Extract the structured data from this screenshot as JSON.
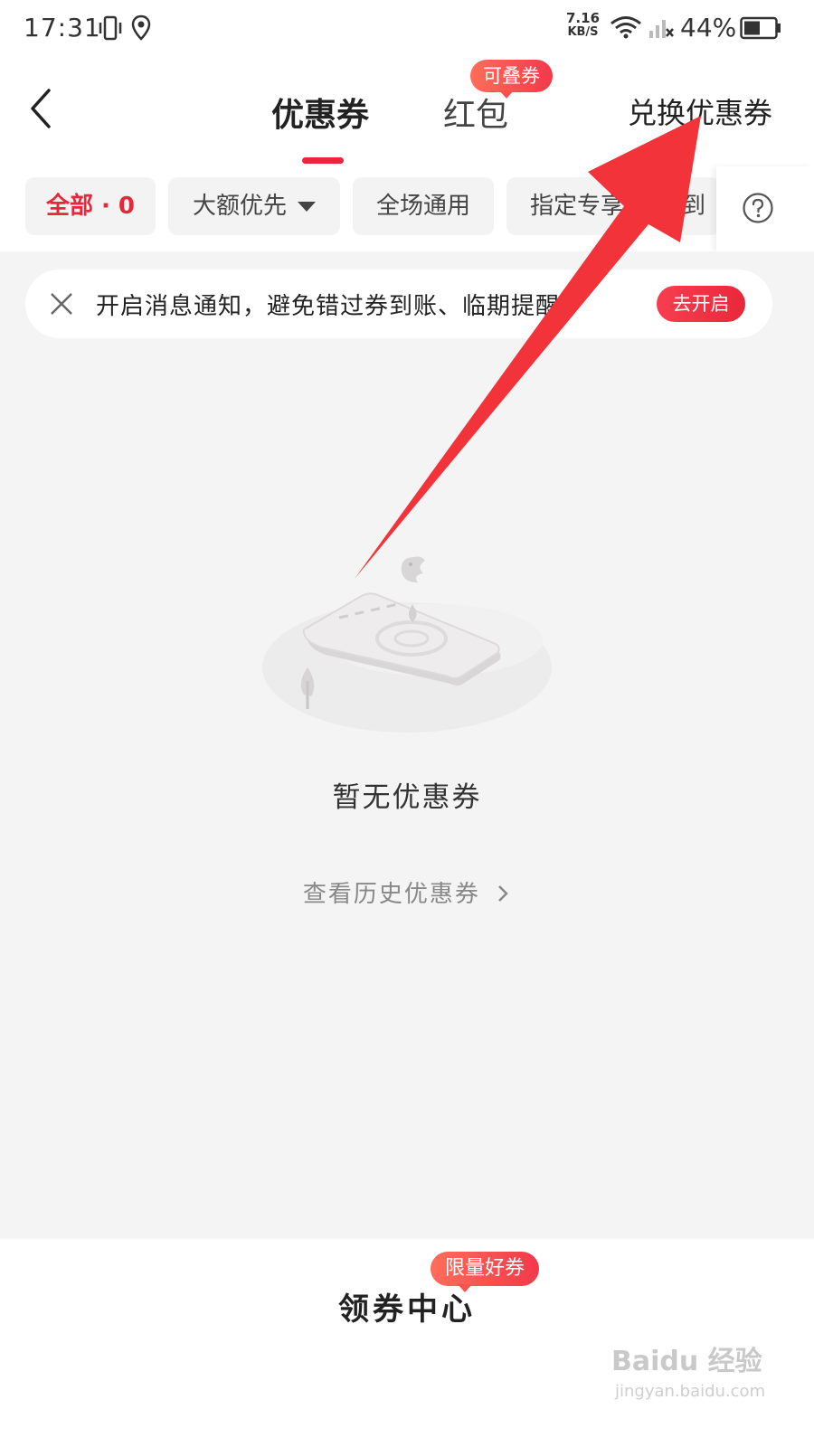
{
  "status_bar": {
    "time": "17:31",
    "net_speed_value": "7.16",
    "net_speed_unit": "KB/S",
    "battery_percent": "44%"
  },
  "header": {
    "tab_coupon": "优惠券",
    "tab_redpack": "红包",
    "redpack_badge": "可叠券",
    "exchange_link": "兑换优惠券"
  },
  "filters": {
    "chips": [
      "全部 · 0",
      "大额优先",
      "全场通用",
      "指定专享",
      "到店"
    ]
  },
  "notice": {
    "text": "开启消息通知，避免错过券到账、临期提醒",
    "button": "去开启"
  },
  "empty": {
    "title": "暂无优惠券",
    "history_link": "查看历史优惠券"
  },
  "bottom": {
    "title": "领券中心",
    "badge": "限量好券"
  },
  "watermark": {
    "logo": "Baidu 经验",
    "url": "jingyan.baidu.com"
  },
  "colors": {
    "accent": "#e8283a",
    "background": "#f4f4f4",
    "arrow": "#f2333a"
  }
}
